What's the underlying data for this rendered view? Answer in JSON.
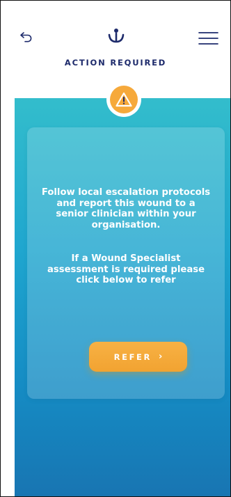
{
  "header": {
    "back_icon": "undo-arrow-icon",
    "logo_icon": "brand-logo-icon",
    "menu_icon": "hamburger-menu-icon",
    "title": "ACTION REQUIRED"
  },
  "alert": {
    "icon": "warning-triangle-icon"
  },
  "card": {
    "paragraph_1": "Follow local escalation protocols and report this wound to a senior clinician within your organisation.",
    "paragraph_2": "If a Wound Specialist assessment is required please click below to refer",
    "refer_button": {
      "label": "REFER",
      "icon": "chevron-right-icon"
    }
  },
  "colors": {
    "navy": "#1d2a6b",
    "teal_top": "#33bdcc",
    "blue_bottom": "#1875b2",
    "accent_orange": "#f6a93b",
    "white": "#ffffff"
  }
}
